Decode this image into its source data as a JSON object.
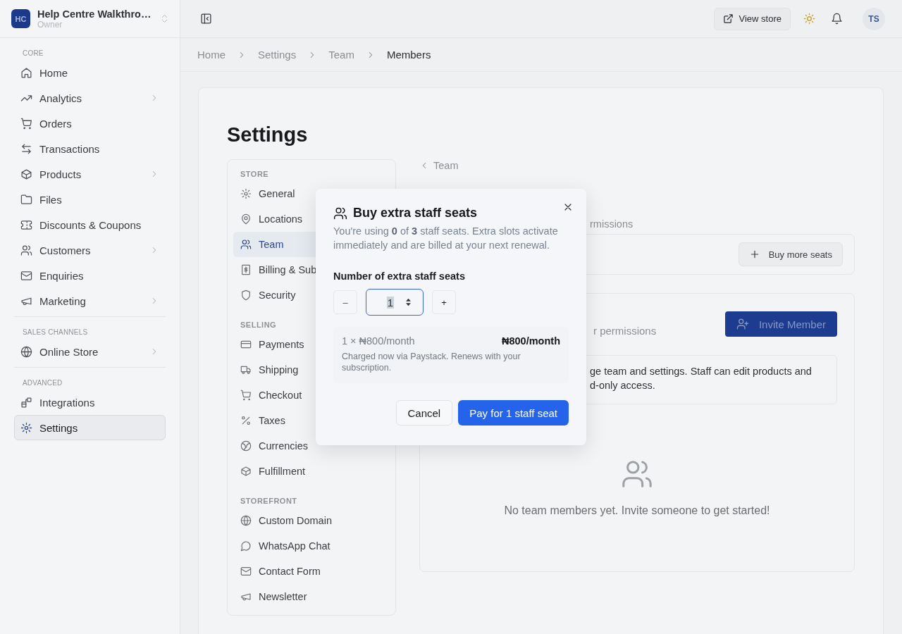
{
  "workspace": {
    "initials": "HC",
    "name": "Help Centre Walkthro…",
    "role": "Owner"
  },
  "sidebar": {
    "groups": [
      {
        "heading": "CORE",
        "items": [
          {
            "label": "Home",
            "selected": false,
            "has_submenu": false
          },
          {
            "label": "Analytics",
            "selected": false,
            "has_submenu": true
          },
          {
            "label": "Orders",
            "selected": false,
            "has_submenu": false
          },
          {
            "label": "Transactions",
            "selected": false,
            "has_submenu": false
          },
          {
            "label": "Products",
            "selected": false,
            "has_submenu": true
          },
          {
            "label": "Files",
            "selected": false,
            "has_submenu": false
          },
          {
            "label": "Discounts & Coupons",
            "selected": false,
            "has_submenu": false
          },
          {
            "label": "Customers",
            "selected": false,
            "has_submenu": true
          },
          {
            "label": "Enquiries",
            "selected": false,
            "has_submenu": false
          },
          {
            "label": "Marketing",
            "selected": false,
            "has_submenu": true
          }
        ]
      },
      {
        "heading": "SALES CHANNELS",
        "items": [
          {
            "label": "Online Store",
            "selected": false,
            "has_submenu": true
          }
        ]
      },
      {
        "heading": "ADVANCED",
        "items": [
          {
            "label": "Integrations",
            "selected": false,
            "has_submenu": false
          },
          {
            "label": "Settings",
            "selected": true,
            "has_submenu": false
          }
        ]
      }
    ]
  },
  "top_bar": {
    "view_store": "View store",
    "avatar": "TS"
  },
  "breadcrumb": [
    "Home",
    "Settings",
    "Team",
    "Members"
  ],
  "page_title": "Settings",
  "settings_nav": {
    "groups": [
      {
        "heading": "STORE",
        "items": [
          {
            "label": "General",
            "selected": false
          },
          {
            "label": "Locations",
            "selected": false
          },
          {
            "label": "Team",
            "selected": true
          },
          {
            "label": "Billing & Sub",
            "selected": false
          },
          {
            "label": "Security",
            "selected": false
          }
        ]
      },
      {
        "heading": "SELLING",
        "items": [
          {
            "label": "Payments",
            "selected": false
          },
          {
            "label": "Shipping",
            "selected": false
          },
          {
            "label": "Checkout",
            "selected": false
          },
          {
            "label": "Taxes",
            "selected": false
          },
          {
            "label": "Currencies",
            "selected": false
          },
          {
            "label": "Fulfillment",
            "selected": false
          }
        ]
      },
      {
        "heading": "STOREFRONT",
        "items": [
          {
            "label": "Custom Domain",
            "selected": false
          },
          {
            "label": "WhatsApp Chat",
            "selected": false
          },
          {
            "label": "Contact Form",
            "selected": false
          },
          {
            "label": "Newsletter",
            "selected": false
          }
        ]
      }
    ]
  },
  "team_panel": {
    "back_link": "Team",
    "tabs_fragment": "rmissions",
    "buy_more_seats": "Buy more seats",
    "members_card": {
      "subtitle_fragment": "r permissions",
      "invite_button": "Invite Member",
      "info_lines": [
        "ge team and settings. Staff can edit products and",
        "d-only access."
      ],
      "empty_text": "No team members yet. Invite someone to get started!"
    }
  },
  "modal": {
    "title": "Buy extra staff seats",
    "description": "You're using **0** of **3** staff seats. Extra slots activate immediately and are billed at your next renewal.",
    "field_label": "Number of extra staff seats",
    "decrement": "–",
    "quantity": "1",
    "increment": "+",
    "line_item": "1 × ₦800/month",
    "line_total": "₦800/month",
    "note": "Charged now via Paystack. Renews with your subscription.",
    "cancel": "Cancel",
    "confirm": "Pay for 1 staff seat"
  }
}
